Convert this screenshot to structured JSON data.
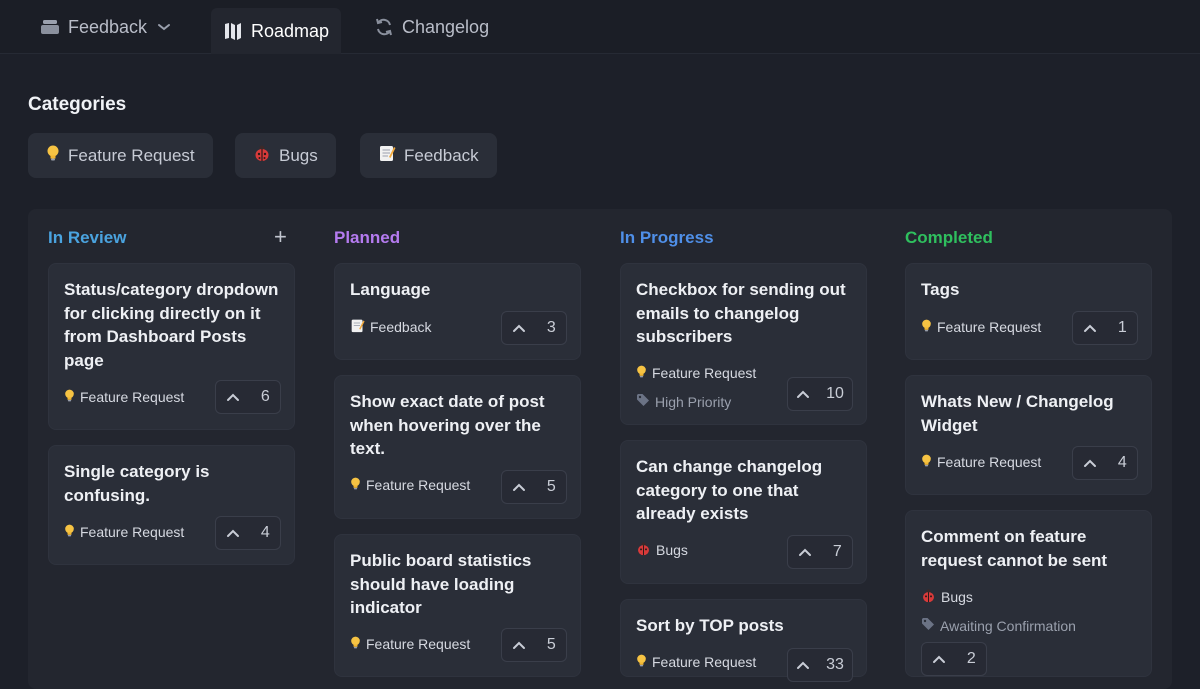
{
  "nav": {
    "feedback_label": "Feedback",
    "roadmap_label": "Roadmap",
    "changelog_label": "Changelog"
  },
  "categories": {
    "title": "Categories",
    "items": [
      {
        "label": "Feature Request",
        "icon": "lightbulb-icon"
      },
      {
        "label": "Bugs",
        "icon": "ladybug-icon"
      },
      {
        "label": "Feedback",
        "icon": "memo-icon"
      }
    ]
  },
  "colors": {
    "in_review": "#4aa3df",
    "planned": "#b57bf0",
    "in_progress": "#4f8fe8",
    "completed": "#2fbf5e"
  },
  "columns": [
    {
      "title": "In Review",
      "cards": [
        {
          "title": "Status/category dropdown for clicking directly on it from Dashboard Posts page",
          "tag": "Feature Request",
          "votes": "6"
        },
        {
          "title": "Single category is confusing.",
          "tag": "Feature Request",
          "votes": "4"
        }
      ]
    },
    {
      "title": "Planned",
      "cards": [
        {
          "title": "Language",
          "tag": "Feedback",
          "votes": "3"
        },
        {
          "title": "Show exact date of post when hovering over the text.",
          "tag": "Feature Request",
          "votes": "5"
        },
        {
          "title": "Public board statistics should have loading indicator",
          "tag": "Feature Request",
          "votes": "5"
        }
      ]
    },
    {
      "title": "In Progress",
      "cards": [
        {
          "title": "Checkbox for sending out emails to changelog subscribers",
          "tag": "Feature Request",
          "status": "High Priority",
          "votes": "10"
        },
        {
          "title": "Can change changelog category to one that already exists",
          "tag": "Bugs",
          "votes": "7"
        },
        {
          "title": "Sort by TOP posts",
          "tag": "Feature Request",
          "votes": "33"
        }
      ]
    },
    {
      "title": "Completed",
      "cards": [
        {
          "title": "Tags",
          "tag": "Feature Request",
          "votes": "1"
        },
        {
          "title": "Whats New / Changelog Widget",
          "tag": "Feature Request",
          "votes": "4"
        },
        {
          "title": "Comment on feature request cannot be sent",
          "tag": "Bugs",
          "status": "Awaiting Confirmation",
          "votes": "2"
        }
      ]
    }
  ]
}
